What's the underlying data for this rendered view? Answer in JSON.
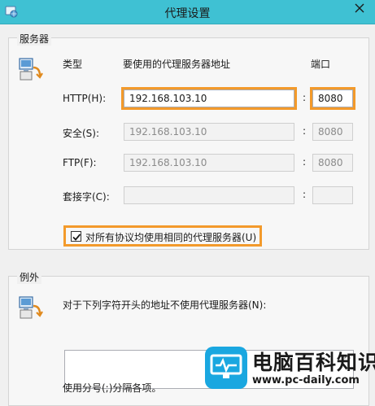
{
  "window": {
    "title": "代理设置",
    "title_icon": "settings-globe-icon",
    "close_icon": "close-icon"
  },
  "servers": {
    "group_title": "服务器",
    "icon": "network-computer-icon",
    "col_type": "类型",
    "col_address": "要使用的代理服务器地址",
    "col_port": "端口",
    "rows": [
      {
        "label": "HTTP(H):",
        "address": "192.168.103.10",
        "port": "8080",
        "enabled": true
      },
      {
        "label": "安全(S):",
        "address": "192.168.103.10",
        "port": "8080",
        "enabled": false
      },
      {
        "label": "FTP(F):",
        "address": "192.168.103.10",
        "port": "8080",
        "enabled": false
      },
      {
        "label": "套接字(C):",
        "address": "",
        "port": "",
        "enabled": false
      }
    ],
    "separator": ":",
    "same_proxy_label": "对所有协议均使用相同的代理服务器(U)",
    "same_proxy_checked": true
  },
  "exceptions": {
    "group_title": "例外",
    "icon": "network-computer-icon",
    "prompt": "对于下列字符开头的地址不使用代理服务器(N):",
    "list_value": "",
    "hint": "使用分号(;)分隔各项。"
  },
  "watermark": {
    "title": "电脑百科知识",
    "url": "www.pc-daily.com",
    "icon": "monitor-logo-icon",
    "brand_color": "#1aa7e0"
  },
  "colors": {
    "titlebar": "#3fc1d3",
    "highlight": "#f39a2b"
  }
}
